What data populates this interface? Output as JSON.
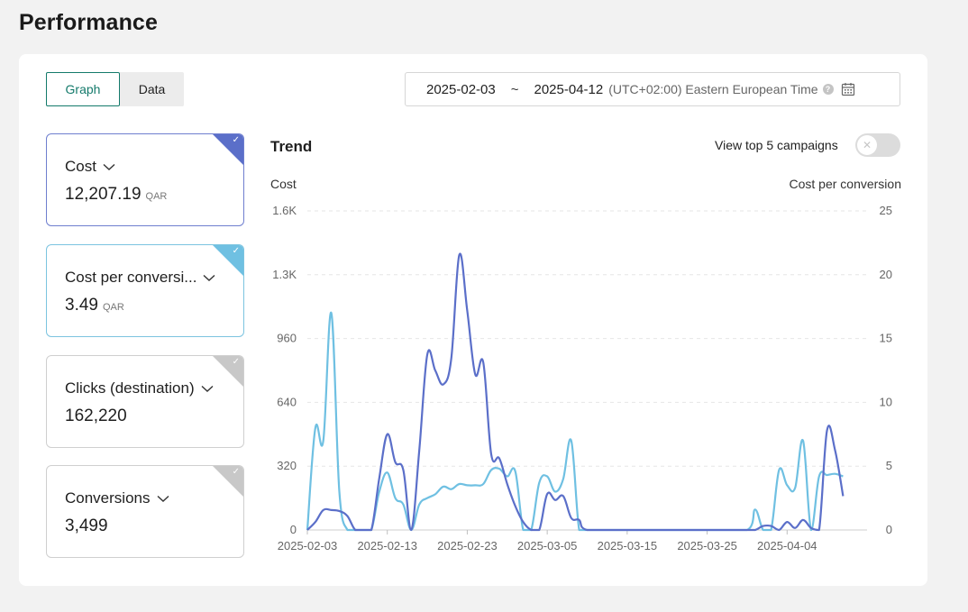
{
  "page": {
    "title": "Performance"
  },
  "view_tabs": [
    {
      "label": "Graph",
      "active": true
    },
    {
      "label": "Data",
      "active": false
    }
  ],
  "date_range": {
    "start": "2025-02-03",
    "separator": "~",
    "end": "2025-04-12",
    "timezone": "(UTC+02:00) Eastern European Time",
    "help_icon": "question-circle-icon",
    "calendar_icon": "calendar-icon"
  },
  "metrics": [
    {
      "name": "Cost",
      "value": "12,207.19",
      "unit": "QAR",
      "selected": true,
      "color": "#5b6fc9"
    },
    {
      "name": "Cost per conversi...",
      "value": "3.49",
      "unit": "QAR",
      "selected": true,
      "color": "#6fc0e2"
    },
    {
      "name": "Clicks (destination)",
      "value": "162,220",
      "unit": "",
      "selected": false,
      "color": "#c8c8c8"
    },
    {
      "name": "Conversions",
      "value": "3,499",
      "unit": "",
      "selected": false,
      "color": "#c8c8c8"
    }
  ],
  "trend": {
    "title": "Trend",
    "top5_label": "View top 5 campaigns",
    "top5_enabled": false
  },
  "chart_data": {
    "type": "line",
    "left_axis_label": "Cost",
    "right_axis_label": "Cost per conversion",
    "x_ticks": [
      "2025-02-03",
      "2025-02-13",
      "2025-02-23",
      "2025-03-05",
      "2025-03-15",
      "2025-03-25",
      "2025-04-04"
    ],
    "y_left_ticks": [
      "0",
      "320",
      "640",
      "960",
      "1.3K",
      "1.6K"
    ],
    "y_right_ticks": [
      "0",
      "5",
      "10",
      "15",
      "20",
      "25"
    ],
    "y_left_range": [
      0,
      1600
    ],
    "y_right_range": [
      0,
      25
    ],
    "grid": "horizontal-dashed",
    "colors": {
      "cost": "#5b6fc9",
      "cpc": "#6fc0e2"
    },
    "x_start": "2025-02-03",
    "series": [
      {
        "name": "Cost",
        "axis": "left",
        "points": [
          [
            0,
            0
          ],
          [
            1,
            40
          ],
          [
            2,
            100
          ],
          [
            3,
            100
          ],
          [
            4,
            95
          ],
          [
            5,
            70
          ],
          [
            6,
            0
          ],
          [
            7,
            0
          ],
          [
            8,
            0
          ],
          [
            9,
            260
          ],
          [
            10,
            480
          ],
          [
            11,
            340
          ],
          [
            12,
            300
          ],
          [
            13,
            0
          ],
          [
            14,
            400
          ],
          [
            15,
            880
          ],
          [
            16,
            800
          ],
          [
            17,
            730
          ],
          [
            18,
            860
          ],
          [
            19,
            1380
          ],
          [
            20,
            1100
          ],
          [
            21,
            780
          ],
          [
            22,
            840
          ],
          [
            23,
            380
          ],
          [
            24,
            360
          ],
          [
            25,
            230
          ],
          [
            26,
            120
          ],
          [
            27,
            40
          ],
          [
            28,
            0
          ],
          [
            29,
            0
          ],
          [
            30,
            180
          ],
          [
            31,
            150
          ],
          [
            32,
            170
          ],
          [
            33,
            60
          ],
          [
            34,
            50
          ],
          [
            35,
            0
          ],
          [
            40,
            0
          ],
          [
            50,
            0
          ],
          [
            55,
            0
          ],
          [
            56,
            0
          ],
          [
            57,
            20
          ],
          [
            58,
            20
          ],
          [
            59,
            0
          ],
          [
            60,
            40
          ],
          [
            61,
            10
          ],
          [
            62,
            50
          ],
          [
            63,
            10
          ],
          [
            64,
            0
          ],
          [
            65,
            500
          ],
          [
            66,
            400
          ],
          [
            67,
            170
          ]
        ]
      },
      {
        "name": "Cost per conversion",
        "axis": "right",
        "points": [
          [
            0,
            0
          ],
          [
            1,
            8
          ],
          [
            2,
            7
          ],
          [
            3,
            17
          ],
          [
            4,
            3
          ],
          [
            5,
            0
          ],
          [
            6,
            0
          ],
          [
            7,
            0
          ],
          [
            8,
            0
          ],
          [
            9,
            3
          ],
          [
            10,
            4.5
          ],
          [
            11,
            2.5
          ],
          [
            12,
            2
          ],
          [
            13,
            0
          ],
          [
            14,
            2
          ],
          [
            15,
            2.5
          ],
          [
            16,
            2.8
          ],
          [
            17,
            3.4
          ],
          [
            18,
            3.2
          ],
          [
            19,
            3.6
          ],
          [
            20,
            3.5
          ],
          [
            21,
            3.5
          ],
          [
            22,
            3.6
          ],
          [
            23,
            4.7
          ],
          [
            24,
            4.8
          ],
          [
            25,
            4.2
          ],
          [
            26,
            4.6
          ],
          [
            27,
            0
          ],
          [
            28,
            0
          ],
          [
            29,
            3.7
          ],
          [
            30,
            4.2
          ],
          [
            31,
            3
          ],
          [
            32,
            4
          ],
          [
            33,
            7
          ],
          [
            34,
            0
          ],
          [
            35,
            0
          ],
          [
            40,
            0
          ],
          [
            50,
            0
          ],
          [
            55,
            0
          ],
          [
            56,
            1.6
          ],
          [
            57,
            0
          ],
          [
            58,
            0
          ],
          [
            59,
            4.7
          ],
          [
            60,
            3.5
          ],
          [
            61,
            3.3
          ],
          [
            62,
            7
          ],
          [
            63,
            0
          ],
          [
            64,
            4.2
          ],
          [
            65,
            4.3
          ],
          [
            66,
            4.4
          ],
          [
            67,
            4.2
          ]
        ]
      }
    ]
  }
}
